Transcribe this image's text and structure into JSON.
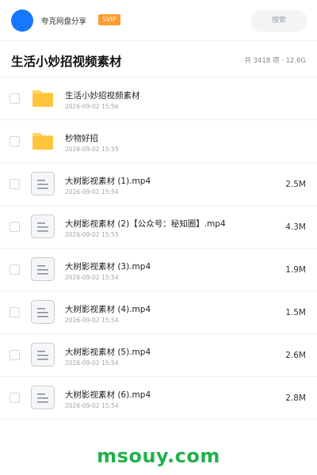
{
  "header": {
    "brand": "夸克网盘分享",
    "badge": "SVIP",
    "search_placeholder": "搜索"
  },
  "title": "生活小妙招视频素材",
  "summary": "共 3418 项 · 12.6G",
  "files": [
    {
      "type": "folder",
      "name": "生活小妙招视频素材",
      "date": "2026-09-02 15:56",
      "size": ""
    },
    {
      "type": "folder",
      "name": "秒物好招",
      "date": "2026-09-02 15:55",
      "size": ""
    },
    {
      "type": "file",
      "name": "大树影视素材 (1).mp4",
      "date": "2026-09-02 15:54",
      "size": "2.5M"
    },
    {
      "type": "file",
      "name": "大树影视素材 (2)【公众号：秘知圈】.mp4",
      "date": "2026-09-02 15:55",
      "size": "4.3M"
    },
    {
      "type": "file",
      "name": "大树影视素材 (3).mp4",
      "date": "2026-09-02 15:54",
      "size": "1.9M"
    },
    {
      "type": "file",
      "name": "大树影视素材 (4).mp4",
      "date": "2026-09-02 15:54",
      "size": "1.5M"
    },
    {
      "type": "file",
      "name": "大树影视素材 (5).mp4",
      "date": "2026-09-02 15:54",
      "size": "2.6M"
    },
    {
      "type": "file",
      "name": "大树影视素材 (6).mp4",
      "date": "2026-09-02 15:54",
      "size": "2.8M"
    }
  ],
  "watermark": "msouy.com",
  "colors": {
    "accent": "#1677ff",
    "svip": "#ff9a2e",
    "folder": "#ffc53d",
    "watermark": "#22b14c"
  }
}
